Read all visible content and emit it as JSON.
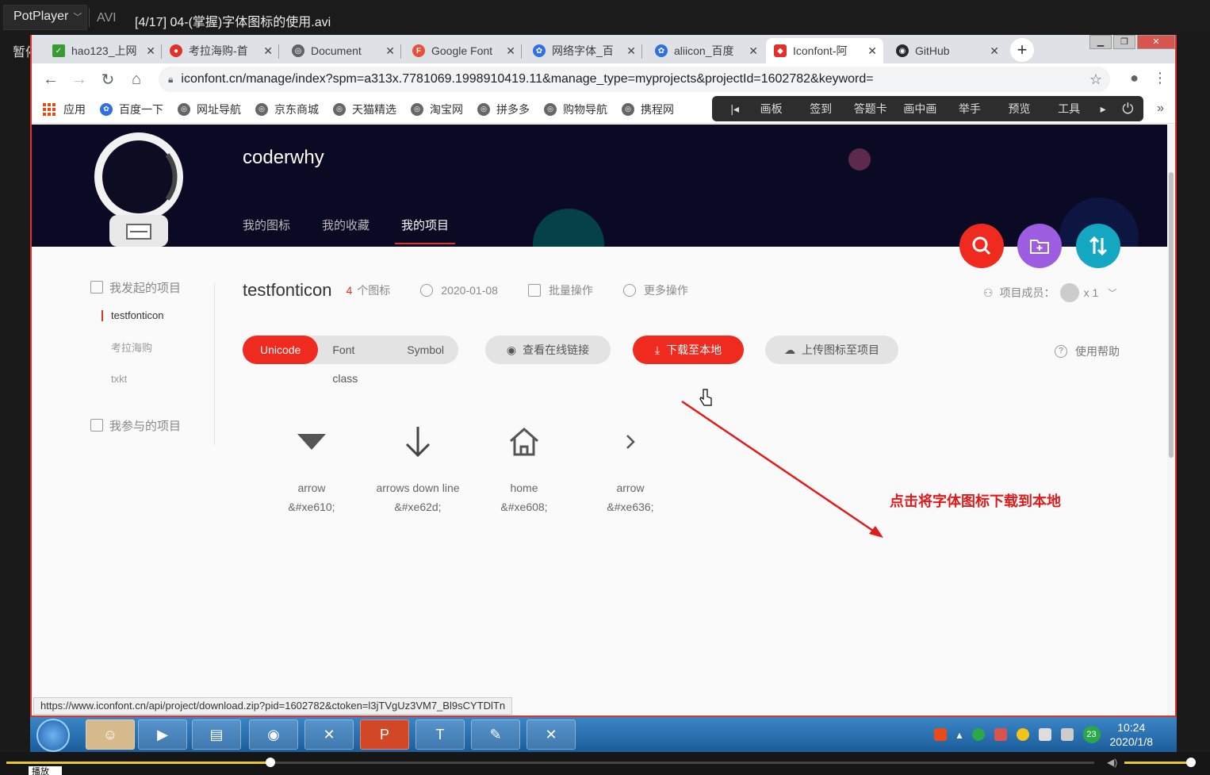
{
  "potplayer": {
    "app_name": "PotPlayer",
    "format": "AVI",
    "file_title": "[4/17] 04-(掌握)字体图标的使用.avi",
    "pause_label": "暂停",
    "play_label": "播放"
  },
  "browser": {
    "tabs": [
      {
        "title": "hao123_上网",
        "icon": "hao123-icon"
      },
      {
        "title": "考拉海购-首",
        "icon": "kaola-icon"
      },
      {
        "title": "Document",
        "icon": "globe-icon"
      },
      {
        "title": "Google Font",
        "icon": "google-fonts-icon"
      },
      {
        "title": "网络字体_百",
        "icon": "baidu-paw-icon"
      },
      {
        "title": "aliicon_百度",
        "icon": "baidu-paw-icon"
      },
      {
        "title": "Iconfont-阿",
        "icon": "iconfont-icon",
        "active": true
      },
      {
        "title": "GitHub",
        "icon": "github-icon"
      }
    ],
    "url": "iconfont.cn/manage/index?spm=a313x.7781069.1998910419.11&manage_type=myprojects&projectId=1602782&keyword=",
    "bookmarks": [
      "应用",
      "百度一下",
      "网址导航",
      "京东商城",
      "天猫精选",
      "淘宝网",
      "拼多多",
      "购物导航",
      "携程网"
    ],
    "extension_toolbar": [
      "画板",
      "签到",
      "答题卡",
      "画中画",
      "举手",
      "预览",
      "工具"
    ],
    "status_url": "https://www.iconfont.cn/api/project/download.zip?pid=1602782&ctoken=l3jTVgUz3VM7_Bl9sCYTDlTn"
  },
  "profile": {
    "username": "coderwhy",
    "nav": [
      "我的图标",
      "我的收藏",
      "我的项目"
    ],
    "active_nav": "我的项目"
  },
  "sidebar": {
    "section_started": "我发起的项目",
    "projects": [
      "testfonticon",
      "考拉海购",
      "txkt"
    ],
    "active_project": "testfonticon",
    "section_joined": "我参与的项目"
  },
  "project": {
    "name": "testfonticon",
    "icon_count": "4",
    "icon_count_unit": "个图标",
    "date": "2020-01-08",
    "batch_label": "批量操作",
    "more_label": "更多操作",
    "members_label": "项目成员：",
    "members_count": "x 1",
    "tabs": [
      "Unicode",
      "Font class",
      "Symbol"
    ],
    "active_tab": "Unicode",
    "view_link_label": "查看在线链接",
    "download_label": "下载至本地",
    "upload_label": "上传图标至项目",
    "help_label": "使用帮助"
  },
  "icons": [
    {
      "name": "arrow",
      "code": "&#xe610;",
      "glyph": "triangle-down-icon"
    },
    {
      "name": "arrows down line",
      "code": "&#xe62d;",
      "glyph": "arrow-down-icon"
    },
    {
      "name": "home",
      "code": "&#xe608;",
      "glyph": "home-icon"
    },
    {
      "name": "arrow",
      "code": "&#xe636;",
      "glyph": "chevron-right-icon"
    }
  ],
  "annotation": "点击将字体图标下载到本地",
  "taskbar": {
    "time": "10:24",
    "date": "2020/1/8",
    "badge": "23"
  },
  "colors": {
    "accent_red": "#ef2a1f",
    "purple": "#9c5de0",
    "teal": "#13a7c2",
    "hero_bg": "#0a0a24"
  },
  "playback": {
    "progress": 0.243,
    "volume": 1.0
  }
}
